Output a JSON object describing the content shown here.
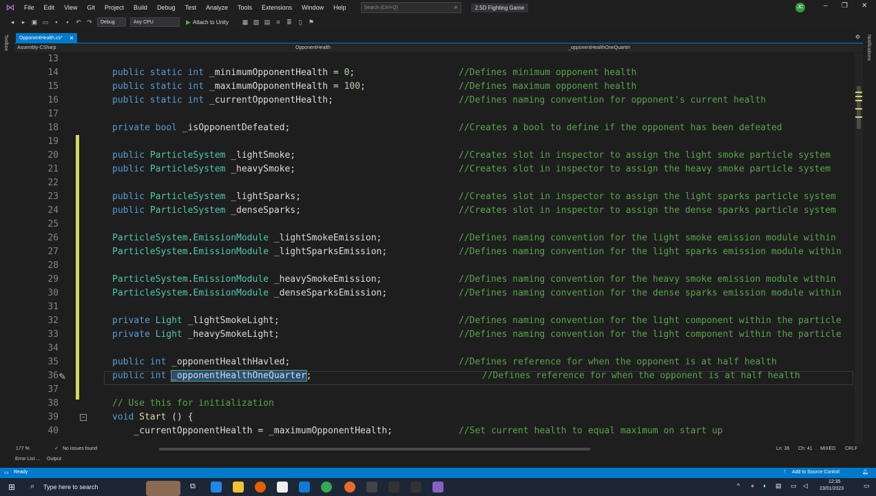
{
  "menu": {
    "items": [
      "File",
      "Edit",
      "View",
      "Git",
      "Project",
      "Build",
      "Debug",
      "Test",
      "Analyze",
      "Tools",
      "Extensions",
      "Window",
      "Help"
    ],
    "search_placeholder": "Search (Ctrl+Q)",
    "solution_name": "2.5D Fighting Game",
    "avatar_initials": "JC"
  },
  "toolbar": {
    "config": "Debug",
    "platform": "Any CPU",
    "attach_label": "Attach to Unity"
  },
  "side": {
    "left_label": "Toolbox",
    "right_label": "Notifications"
  },
  "tab": {
    "title": "OpponentHealth.cs*"
  },
  "nav": {
    "project": "Assembly-CSharp",
    "class": "OpponentHealth",
    "member": "_opponentHealthOneQuarter"
  },
  "editor": {
    "line_numbers": [
      "13",
      "14",
      "15",
      "16",
      "17",
      "18",
      "19",
      "20",
      "21",
      "22",
      "23",
      "24",
      "25",
      "26",
      "27",
      "28",
      "29",
      "30",
      "31",
      "32",
      "33",
      "34",
      "35",
      "36",
      "37",
      "38",
      "39",
      "40"
    ],
    "lines": {
      "l14a": "public static int",
      "l14b": " _minimumOpponentHealth = ",
      "l14n": "0",
      "l14c": ";",
      "l15a": "public static int",
      "l15b": " _maximumOpponentHealth = ",
      "l15n": "100",
      "l15c": ";",
      "l16a": "public static int",
      "l16b": " _currentOpponentHealth;",
      "l18a": "private bool",
      "l18b": " _isOpponentDefeated;",
      "l20a": "public ",
      "l20t": "ParticleSystem",
      "l20b": " _lightSmoke;",
      "l21a": "public ",
      "l21t": "ParticleSystem",
      "l21b": " _heavySmoke;",
      "l23a": "public ",
      "l23t": "ParticleSystem",
      "l23b": " _lightSparks;",
      "l24a": "public ",
      "l24t": "ParticleSystem",
      "l24b": " _denseSparks;",
      "l26t": "ParticleSystem",
      "l26m": ".",
      "l26t2": "EmissionModule",
      "l26b": " _lightSmokeEmission;",
      "l27t": "ParticleSystem",
      "l27m": ".",
      "l27t2": "EmissionModule",
      "l27b": " _lightSparksEmission;",
      "l29t": "ParticleSystem",
      "l29m": ".",
      "l29t2": "EmissionModule",
      "l29b": " _heavySmokeEmission;",
      "l30t": "ParticleSystem",
      "l30m": ".",
      "l30t2": "EmissionModule",
      "l30b": " _denseSparksEmission;",
      "l32a": "private ",
      "l32t": "Light",
      "l32b": " _lightSmokeLight;",
      "l33a": "private ",
      "l33t": "Light",
      "l33b": " _heavySmokeLight;",
      "l35a": "public int",
      "l35b": " _opponentHealthHavled;",
      "l36a": "public int",
      "l36sel": "_opponentHealthOneQuarter",
      "l36c": ";",
      "l38": "// Use this for initialization",
      "l39a": "void",
      "l39f": " Start",
      "l39b": " () {",
      "l40": "    _currentOpponentHealth = _maximumOpponentHealth;"
    },
    "comments": {
      "c14": "//Defines minimum opponent health",
      "c15": "//Defines maximum opponent health",
      "c16": "//Defines naming convention for opponent's current health",
      "c18": "//Creates a bool to define if the opponent has been defeated",
      "c20": "//Creates slot in inspector to assign the light smoke particle system",
      "c21": "//Creates slot in inspector to assign the heavy smoke particle system",
      "c23": "//Creates slot in inspector to assign the light sparks particle system",
      "c24": "//Creates slot in inspector to assign the dense sparks particle system",
      "c26": "//Defines naming convention for the light smoke emission module within",
      "c27": "//Defines naming convention for the light sparks emission module within",
      "c29": "//Defines naming convention for the heavy smoke emission module within",
      "c30": "//Defines naming convention for the dense sparks emission module within",
      "c32": "//Defines naming convention for the light component within the particle",
      "c33": "//Defines naming convention for the light component within the particle",
      "c35": "//Defines reference for when the opponent is at half health",
      "c36": "//Defines reference for when the opponent is at half health",
      "c40": "//Set current health to equal maximum on start up"
    }
  },
  "status_row": {
    "zoom": "177 %",
    "issues": "No issues found",
    "ln": "Ln: 36",
    "ch": "Ch: 41",
    "mixed": "MIXED",
    "crlf": "CRLF"
  },
  "bottom_tabs": [
    "Error List ...",
    "Output"
  ],
  "vs_status": {
    "ready": "Ready",
    "source_control": "Add to Source Control"
  },
  "taskbar": {
    "search_placeholder": "Type here to search",
    "time": "12:35",
    "date": "23/01/2023"
  },
  "colors": {
    "accent": "#007acc",
    "comment": "#57a64a",
    "keyword": "#569cd6",
    "type": "#4ec9b0",
    "change_bar": "#d7d75f"
  }
}
